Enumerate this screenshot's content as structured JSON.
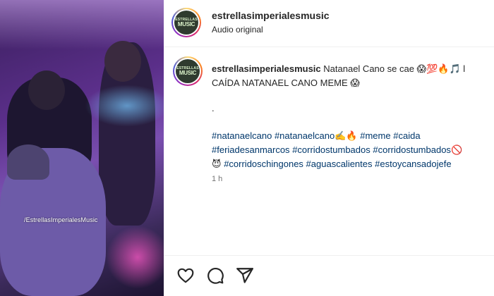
{
  "media": {
    "watermark": "/EstrellasImperialesMusic"
  },
  "avatar": {
    "logo_line1": "ESTRELLAS",
    "logo_line2": "MUSIC"
  },
  "header": {
    "username": "estrellasimperialesmusic",
    "audio_label": "Audio original"
  },
  "caption": {
    "username": "estrellasimperialesmusic",
    "text": "Natanael Cano se cae 😱💯🔥🎵 l",
    "line2": "CAÍDA NATANAEL CANO MEME 😱",
    "dot": "."
  },
  "hashtags": {
    "line1": [
      {
        "text": "#natanaelcano",
        "suffix": ""
      },
      {
        "text": "#natanaelcano",
        "suffix": "✍️🔥"
      },
      {
        "text": "#meme",
        "suffix": ""
      },
      {
        "text": "#caida",
        "suffix": ""
      }
    ],
    "line2": [
      {
        "text": "#feriadesanmarcos",
        "suffix": ""
      },
      {
        "text": "#corridostumbados",
        "suffix": ""
      },
      {
        "text": "#corridostumbados",
        "suffix": "🚫"
      }
    ],
    "line3_prefix": "😈",
    "line3": [
      {
        "text": "#corridoschingones",
        "suffix": ""
      },
      {
        "text": "#aguascalientes",
        "suffix": ""
      },
      {
        "text": "#estoycansadojefe",
        "suffix": ""
      }
    ]
  },
  "timestamp": "1 h",
  "actions": {
    "like_icon": "heart-icon",
    "comment_icon": "comment-icon",
    "share_icon": "share-icon"
  },
  "colors": {
    "hashtag": "#00376b",
    "text": "#262626",
    "muted": "#737373"
  }
}
